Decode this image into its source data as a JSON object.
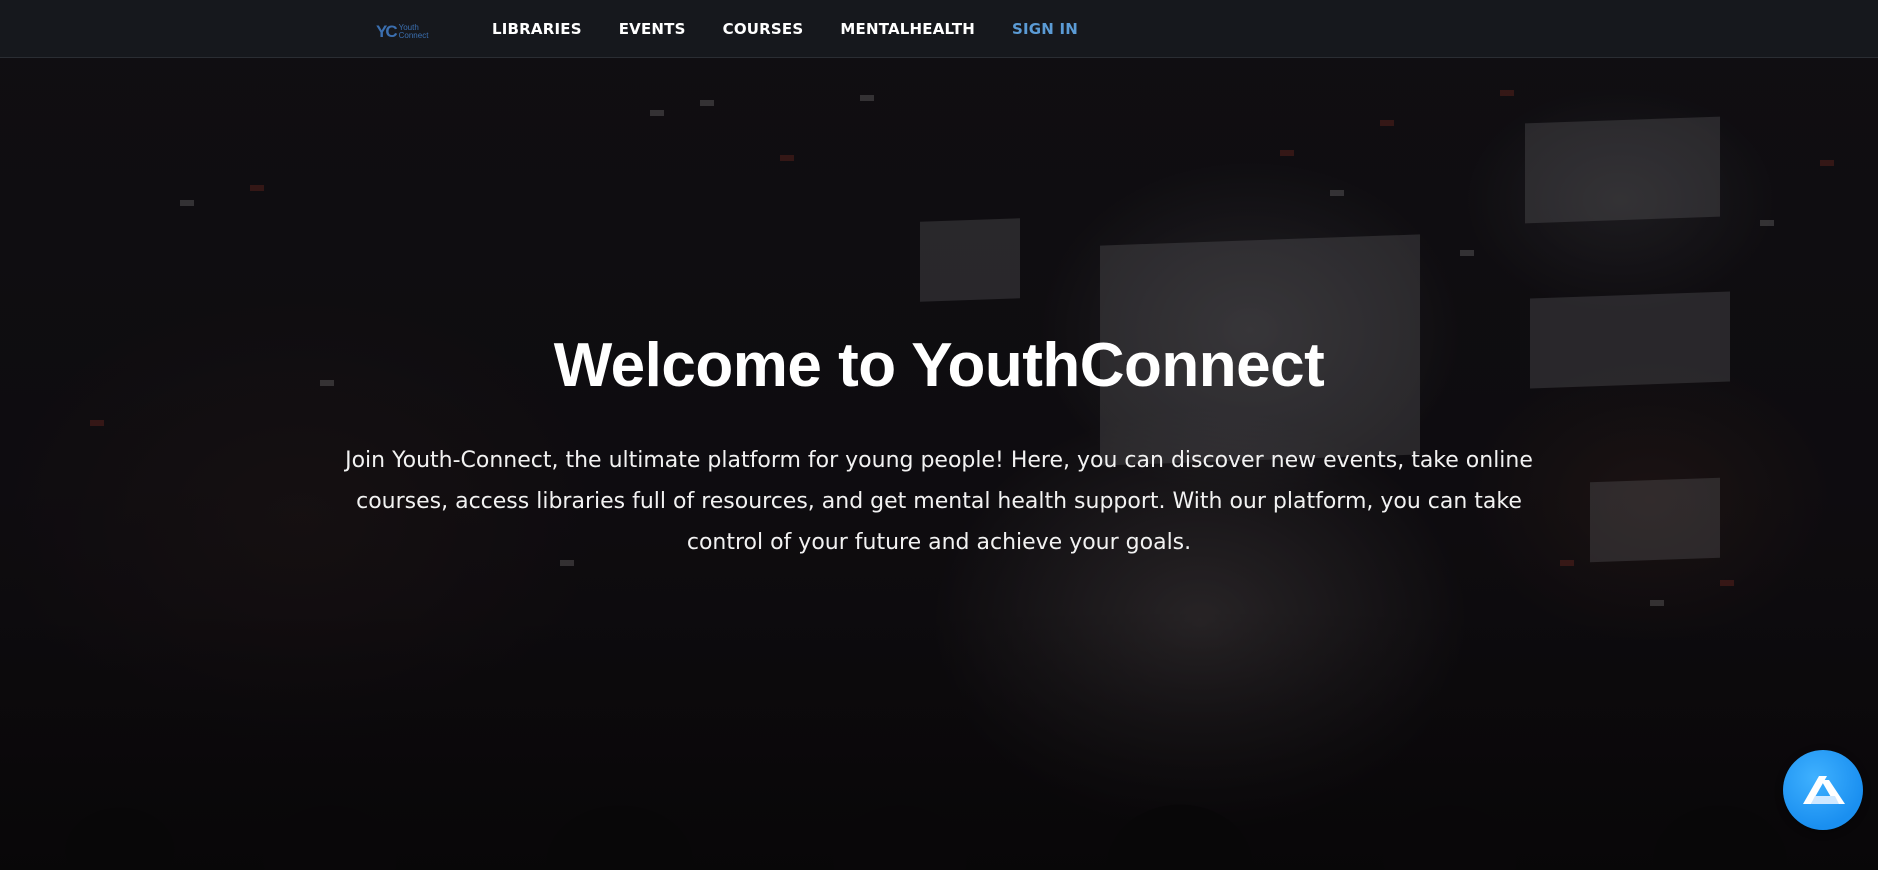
{
  "brand": {
    "logo_mark": "YC",
    "logo_line1": "Youth",
    "logo_line2": "Connect"
  },
  "nav": {
    "items": [
      {
        "label": "LIBRARIES"
      },
      {
        "label": "EVENTS"
      },
      {
        "label": "COURSES"
      },
      {
        "label": "MENTALHEALTH"
      },
      {
        "label": "SIGN IN"
      }
    ]
  },
  "hero": {
    "title": "Welcome to YouthConnect",
    "description": "Join Youth-Connect, the ultimate platform for young people! Here, you can discover new events, take online courses, access libraries full of resources, and get mental health support. With our platform, you can take control of your future and achieve your goals."
  },
  "assistant": {
    "icon": "assistant-logo-icon"
  },
  "colors": {
    "navbar_bg": "#16181d",
    "nav_text": "#ffffff",
    "signin_accent": "#5b9bd5",
    "logo": "#3b6fb0",
    "assistant_bg": "#1a8ff0"
  }
}
